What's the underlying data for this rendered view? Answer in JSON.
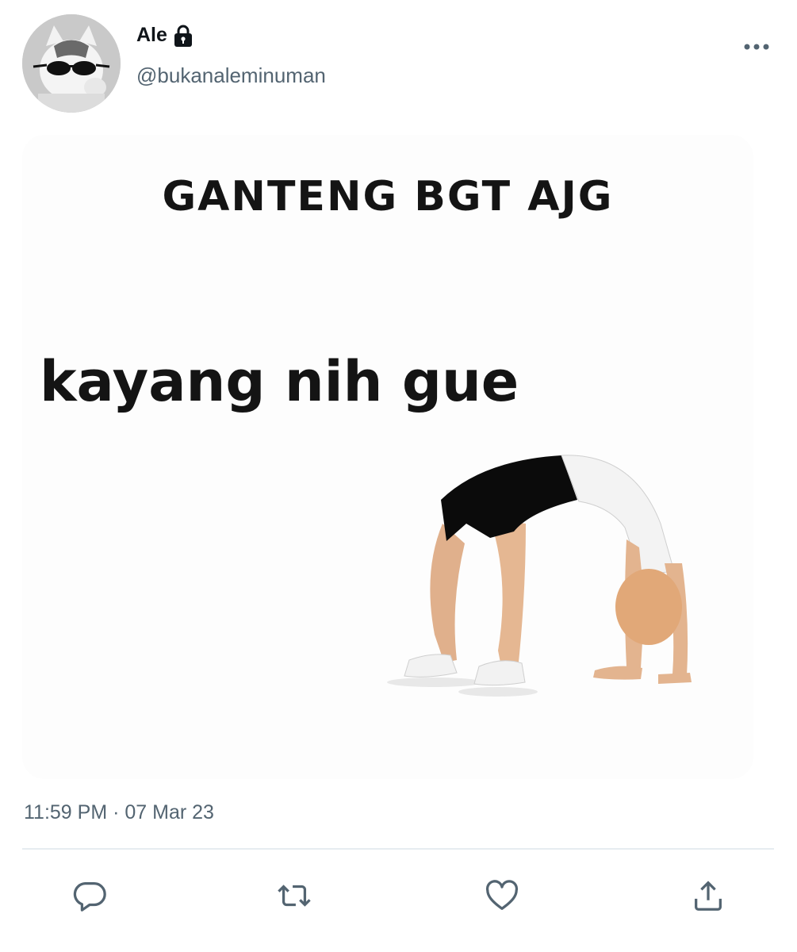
{
  "user": {
    "display_name": "Ale",
    "handle": "@bukanaleminuman"
  },
  "media": {
    "title": "GANTENG BGT AJG",
    "caption": "kayang nih gue"
  },
  "timestamp": "11:59 PM · 07 Mar 23",
  "actions": [
    {
      "name": "reply",
      "icon": "reply-icon"
    },
    {
      "name": "retweet",
      "icon": "retweet-icon"
    },
    {
      "name": "like",
      "icon": "heart-icon"
    },
    {
      "name": "share",
      "icon": "share-icon"
    }
  ],
  "colors": {
    "text_primary": "#0f1419",
    "text_secondary": "#536471",
    "divider": "#e6ecf0"
  }
}
